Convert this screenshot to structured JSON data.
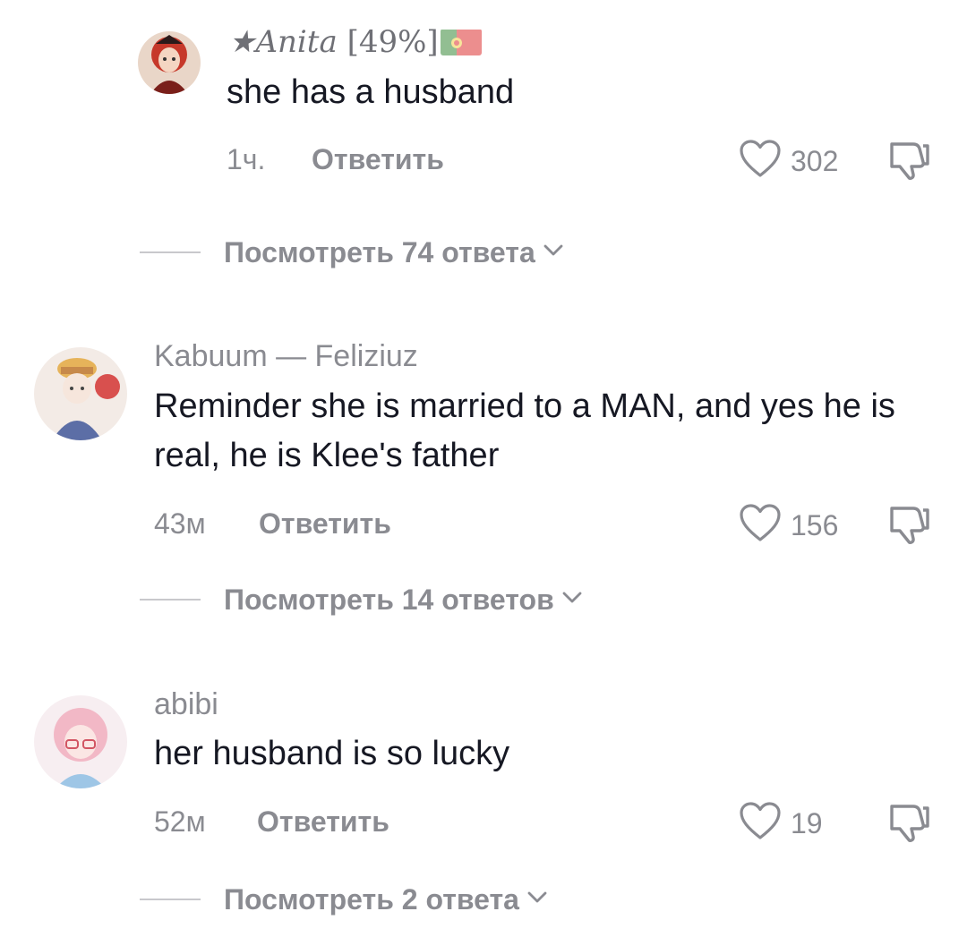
{
  "comments": [
    {
      "username": "★Anita",
      "username_suffix": "[49%]",
      "text": "she has a husband",
      "time": "1ч.",
      "reply_label": "Ответить",
      "likes": "302",
      "view_replies": "Посмотреть 74 ответа"
    },
    {
      "username": "Kabuum — Feliziuz",
      "text": "Reminder she is married to a MAN, and yes he is real, he is Klee's father",
      "time": "43м",
      "reply_label": "Ответить",
      "likes": "156",
      "view_replies": "Посмотреть 14 ответов"
    },
    {
      "username": "abibi",
      "text": "her husband is so lucky",
      "time": "52м",
      "reply_label": "Ответить",
      "likes": "19",
      "view_replies": "Посмотреть 2 ответа"
    }
  ],
  "colors": {
    "primary_text": "#161823",
    "secondary_text": "#8a8b91",
    "divider": "#c8c8cc"
  },
  "icons": {
    "like": "heart-outline-icon",
    "dislike": "thumbs-down-icon",
    "expand": "chevron-down-icon"
  }
}
